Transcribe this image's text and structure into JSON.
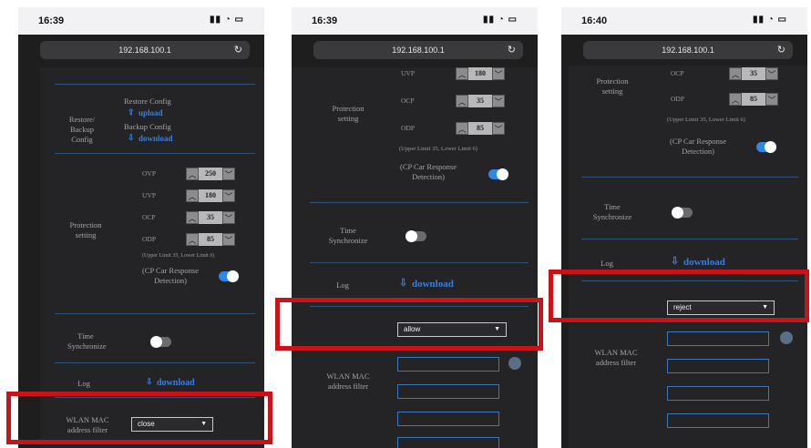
{
  "screens": [
    {
      "time": "16:39",
      "url": "192.168.100.1",
      "config": {
        "label": "Restore/ Backup Config",
        "restore_title": "Restore Config",
        "upload": "upload",
        "backup_title": "Backup Config",
        "download": "download"
      },
      "protection": {
        "label": "Protection setting",
        "ovp_label": "OVP",
        "ovp": "250",
        "uvp_label": "UVP",
        "uvp": "180",
        "ocp_label": "OCP",
        "ocp": "35",
        "odp_label": "ODP",
        "odp": "85",
        "note": "(Upper Limit 35, Lower Limit 6)",
        "cp_label": "(CP Car Response Detection)"
      },
      "time_sync_label": "Time Synchronize",
      "log_label": "Log",
      "log_download": "download",
      "wlan_label": "WLAN MAC address filter",
      "wlan_select": "close"
    },
    {
      "time": "16:39",
      "url": "192.168.100.1",
      "protection": {
        "label": "Protection setting",
        "uvp_label": "UVP",
        "uvp": "180",
        "ocp_label": "OCP",
        "ocp": "35",
        "odp_label": "ODP",
        "odp": "85",
        "note": "(Upper Limit 35, Lower Limit 6)",
        "cp_label": "(CP Car Response Detection)"
      },
      "time_sync_label": "Time Synchronize",
      "log_label": "Log",
      "log_download": "download",
      "wlan_label": "WLAN MAC address filter",
      "wlan_select": "allow"
    },
    {
      "time": "16:40",
      "url": "192.168.100.1",
      "protection": {
        "label": "Protection setting",
        "ocp_label": "OCP",
        "ocp": "35",
        "odp_label": "ODP",
        "odp": "85",
        "note": "(Upper Limit 35, Lower Limit 6)",
        "cp_label": "(CP Car Response Detection)"
      },
      "time_sync_label": "Time Synchronize",
      "log_label": "Log",
      "log_download": "download",
      "wlan_label": "WLAN MAC address filter",
      "wlan_select": "reject"
    }
  ],
  "icons": {
    "upload": "upload-icon",
    "download": "download-icon",
    "reload": "reload-icon",
    "caret": "chevron-down-icon"
  },
  "colors": {
    "highlight": "#c9131a",
    "accent": "#2f86e6",
    "link": "#3b7ed8",
    "panel": "#242426"
  }
}
